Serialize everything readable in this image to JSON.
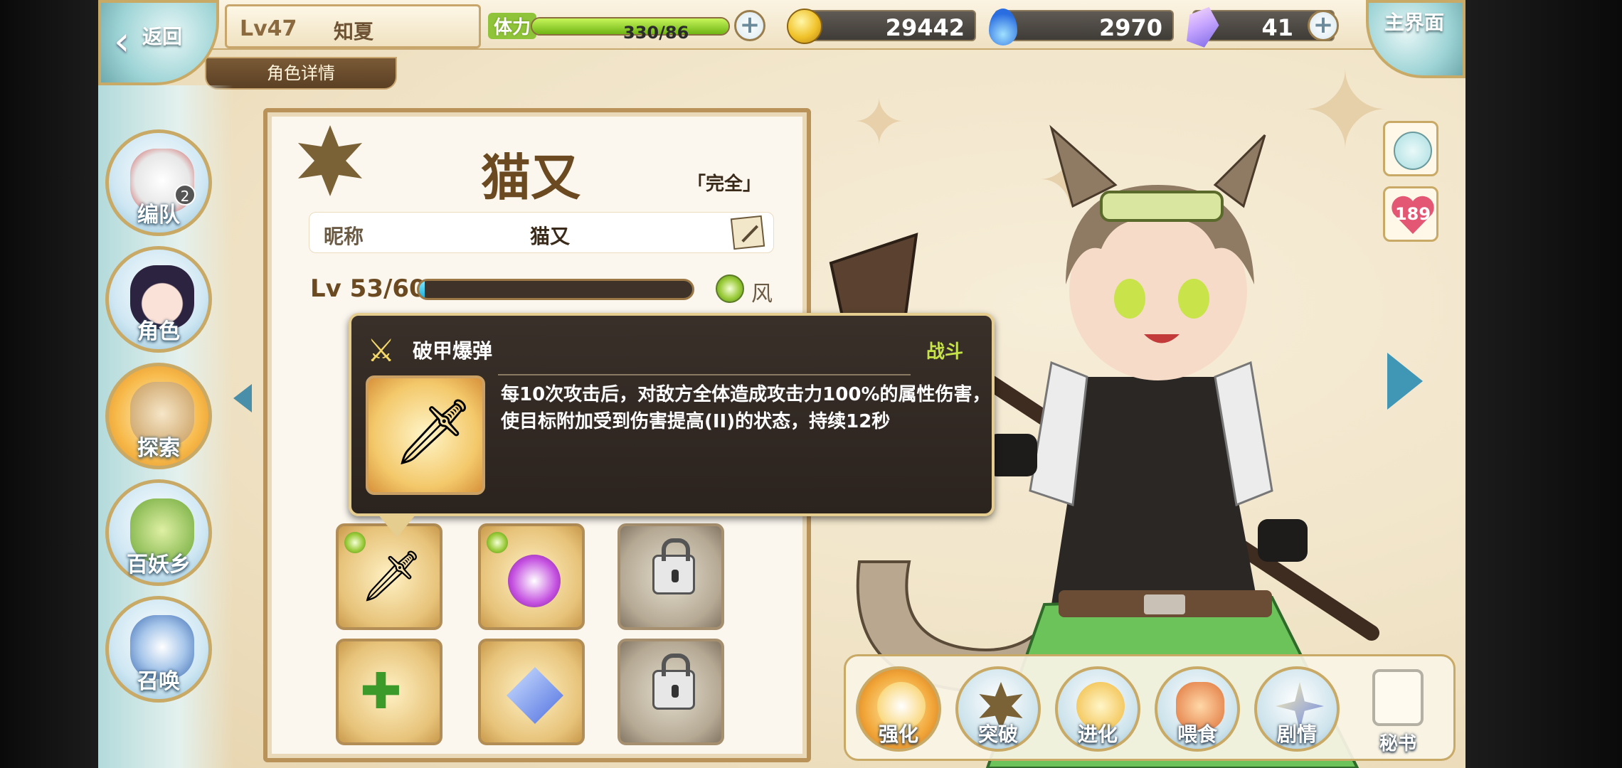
{
  "topbar": {
    "back_label": "返回",
    "player_level": "Lv47",
    "player_name": "知夏",
    "sub_title": "角色详情",
    "stamina_label": "体力",
    "stamina_text": "330/86",
    "stamina_fraction": 1.0,
    "gold": "29442",
    "spirit": "2970",
    "gems": "41",
    "home_label": "主界面"
  },
  "nav": {
    "items": [
      {
        "label": "编队",
        "icon": "team-icon",
        "badge": "2"
      },
      {
        "label": "角色",
        "icon": "character-icon"
      },
      {
        "label": "探索",
        "icon": "explore-icon"
      },
      {
        "label": "百妖乡",
        "icon": "village-icon"
      },
      {
        "label": "召唤",
        "icon": "summon-icon"
      }
    ]
  },
  "character": {
    "name": "猫又",
    "state": "「完全」",
    "nickname_label": "昵称",
    "nickname": "猫又",
    "level_text": "Lv 53/60",
    "exp_fraction": 0.02,
    "element": "风"
  },
  "tooltip": {
    "title": "破甲爆弹",
    "type": "战斗",
    "description": "每10次攻击后，对敌方全体造成攻击力100%的属性伤害，\n使目标附加受到伤害提高(II)的状态，持续12秒"
  },
  "skills": [
    {
      "icon": "dagger-skill-icon",
      "locked": false,
      "element": "wind"
    },
    {
      "icon": "orb-skill-icon",
      "locked": false,
      "element": "wind"
    },
    {
      "icon": "spear-skill-icon",
      "locked": true
    },
    {
      "icon": "herb-bag-skill-icon",
      "locked": false
    },
    {
      "icon": "crystal-skill-icon",
      "locked": false
    },
    {
      "icon": "whip-skill-icon",
      "locked": true
    }
  ],
  "side": {
    "affection": "189"
  },
  "dock": {
    "items": [
      {
        "label": "强化",
        "icon": "enhance-icon"
      },
      {
        "label": "突破",
        "icon": "breakthrough-icon"
      },
      {
        "label": "进化",
        "icon": "evolve-icon"
      },
      {
        "label": "喂食",
        "icon": "feed-icon"
      },
      {
        "label": "剧情",
        "icon": "story-icon"
      }
    ],
    "book_label": "秘书"
  },
  "colors": {
    "accent_gold": "#c9a966",
    "panel_brown": "#6b4a22",
    "wind_green": "#9acb3a",
    "tooltip_bg": "#2b231e"
  }
}
